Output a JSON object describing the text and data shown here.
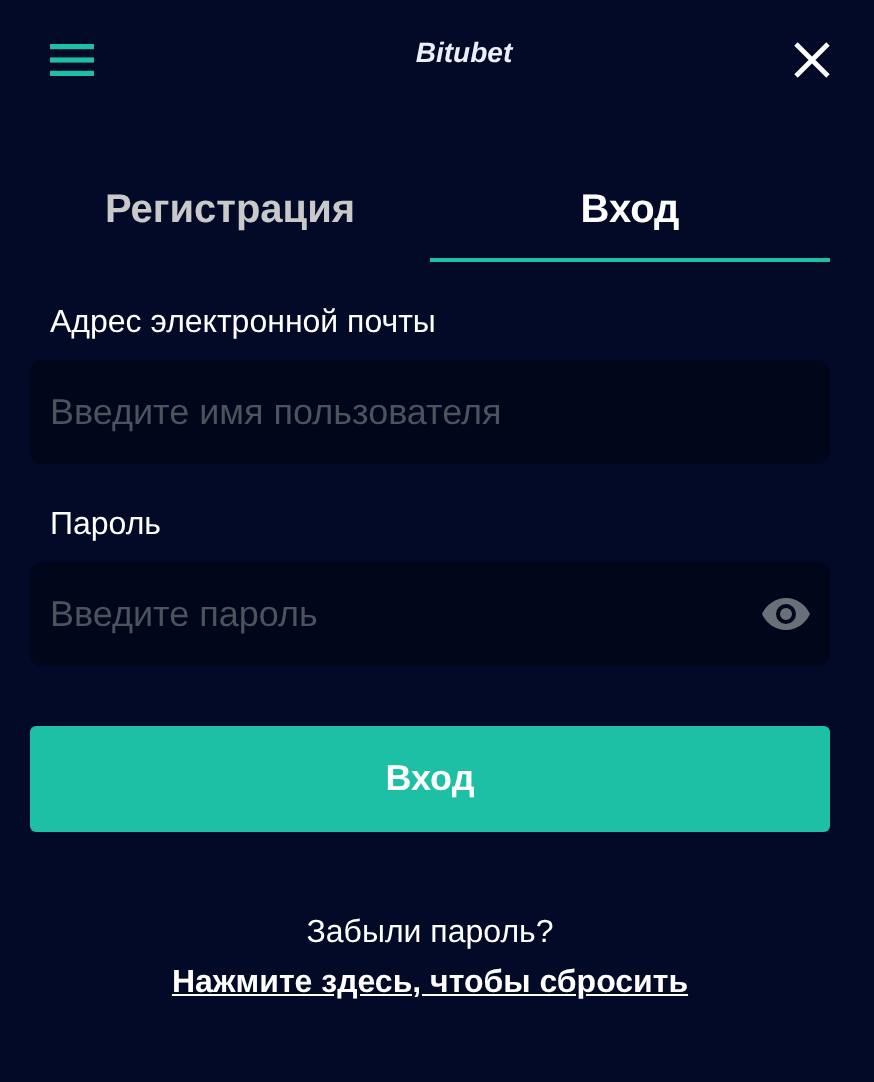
{
  "header": {
    "logo": "Bitubet"
  },
  "tabs": [
    {
      "label": "Регистрация",
      "selected": false
    },
    {
      "label": "Вход",
      "selected": true
    }
  ],
  "fields": [
    {
      "label": "Адрес электронной почты",
      "placeholder": "Введите имя пользователя",
      "kind": "text"
    },
    {
      "label": "Пароль",
      "placeholder": "Введите пароль",
      "kind": "password"
    }
  ],
  "submit": "Вход",
  "forgot": {
    "question": "Забыли пароль?",
    "link": "Нажмите здесь, чтобы сбросить"
  }
}
